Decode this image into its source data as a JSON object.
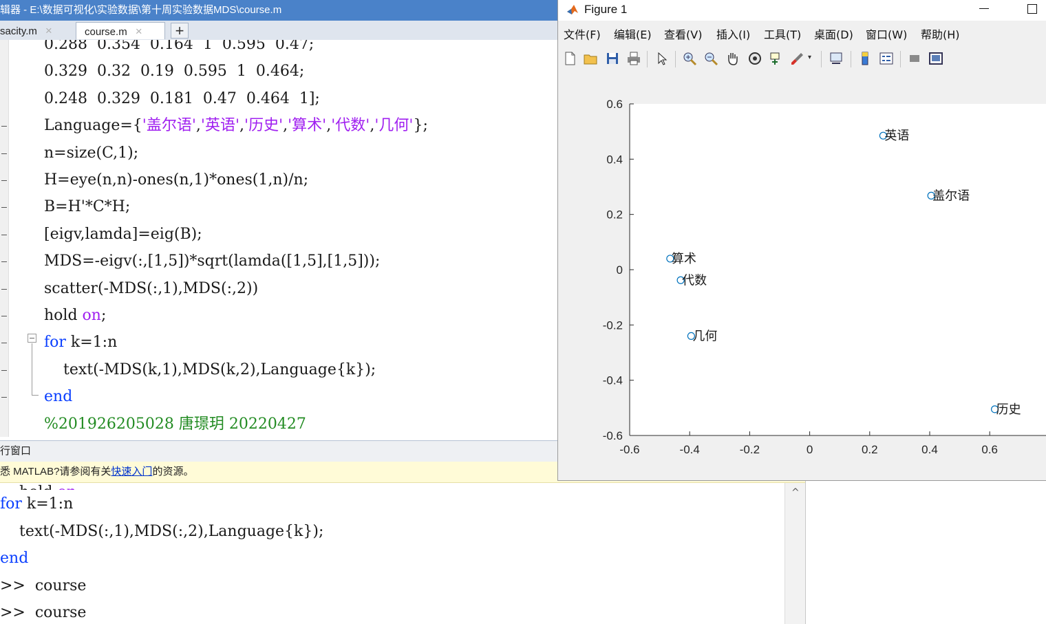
{
  "editor": {
    "title": "辑器 - E:\\数据可视化\\实验数据\\第十周实验数据MDS\\course.m",
    "tabs": [
      {
        "label": "sacity.m",
        "close": "×"
      },
      {
        "label": "course.m",
        "close": "×"
      }
    ],
    "add_tab": "+",
    "code_lines": [
      {
        "segs": [
          {
            "t": "0.288  0.354  0.164  1  0.595  0.47;",
            "c": ""
          }
        ]
      },
      {
        "segs": [
          {
            "t": "0.329  0.32  0.19  0.595  1  0.464;",
            "c": ""
          }
        ]
      },
      {
        "segs": [
          {
            "t": "0.248  0.329  0.181  0.47  0.464  1];",
            "c": ""
          }
        ]
      },
      {
        "segs": [
          {
            "t": "Language={",
            "c": ""
          },
          {
            "t": "'盖尔语'",
            "c": "str"
          },
          {
            "t": ",",
            "c": ""
          },
          {
            "t": "'英语'",
            "c": "str"
          },
          {
            "t": ",",
            "c": ""
          },
          {
            "t": "'历史'",
            "c": "str"
          },
          {
            "t": ",",
            "c": ""
          },
          {
            "t": "'算术'",
            "c": "str"
          },
          {
            "t": ",",
            "c": ""
          },
          {
            "t": "'代数'",
            "c": "str"
          },
          {
            "t": ",",
            "c": ""
          },
          {
            "t": "'几何'",
            "c": "str"
          },
          {
            "t": "};",
            "c": ""
          }
        ]
      },
      {
        "segs": [
          {
            "t": "n=size(C,1);",
            "c": ""
          }
        ]
      },
      {
        "segs": [
          {
            "t": "H=eye(n,n)-ones(n,1)*ones(1,n)/n;",
            "c": ""
          }
        ]
      },
      {
        "segs": [
          {
            "t": "B=H'*C*H;",
            "c": ""
          }
        ]
      },
      {
        "segs": [
          {
            "t": "[eigv,lamda]=eig(B);",
            "c": ""
          }
        ]
      },
      {
        "segs": [
          {
            "t": "MDS=-eigv(:,[1,5])*sqrt(lamda([1,5],[1,5]));",
            "c": ""
          }
        ]
      },
      {
        "segs": [
          {
            "t": "scatter(-MDS(:,1),MDS(:,2))",
            "c": ""
          }
        ]
      },
      {
        "segs": [
          {
            "t": "hold ",
            "c": ""
          },
          {
            "t": "on",
            "c": "str"
          },
          {
            "t": ";",
            "c": ""
          }
        ]
      },
      {
        "segs": [
          {
            "t": "for",
            "c": "kw"
          },
          {
            "t": " k=1:n",
            "c": ""
          }
        ]
      },
      {
        "segs": [
          {
            "t": "    text(-MDS(k,1),MDS(k,2),Language{k});",
            "c": ""
          }
        ]
      },
      {
        "segs": [
          {
            "t": "end",
            "c": "kw"
          }
        ]
      },
      {
        "segs": [
          {
            "t": "%201926205028 唐璟玥 20220427",
            "c": "cmt"
          }
        ]
      }
    ]
  },
  "command_window": {
    "header": "行窗口",
    "tip_prefix": "悉 MATLAB?请参阅有关",
    "tip_link": "快速入门",
    "tip_suffix": "的资源。",
    "lines": [
      {
        "segs": [
          {
            "t": "for",
            "c": "kw"
          },
          {
            "t": " k=1:n",
            "c": ""
          }
        ]
      },
      {
        "segs": [
          {
            "t": "    text(-MDS(:,1),MDS(:,2),Language{k});",
            "c": ""
          }
        ]
      },
      {
        "segs": [
          {
            "t": "end",
            "c": "kw"
          }
        ]
      },
      {
        "segs": [
          {
            "t": ">>  course",
            "c": ""
          }
        ]
      },
      {
        "segs": [
          {
            "t": ">>  course",
            "c": ""
          }
        ]
      }
    ],
    "scroll_up": "^"
  },
  "figure": {
    "title": "Figure 1",
    "menu": [
      "文件(F)",
      "编辑(E)",
      "查看(V)",
      "插入(I)",
      "工具(T)",
      "桌面(D)",
      "窗口(W)",
      "帮助(H)"
    ],
    "toolbar_icons": [
      "new-figure-icon",
      "open-file-icon",
      "save-icon",
      "print-icon",
      "pointer-icon",
      "zoom-in-icon",
      "zoom-out-icon",
      "pan-hand-icon",
      "rotate-3d-icon",
      "data-cursor-icon",
      "brush-icon",
      "link-plot-icon",
      "colorbar-icon",
      "legend-icon",
      "hide-plot-tools-icon",
      "show-plot-tools-icon"
    ]
  },
  "chart_data": {
    "type": "scatter",
    "title": "",
    "xlabel": "",
    "ylabel": "",
    "xlim": [
      -0.6,
      0.8
    ],
    "ylim": [
      -0.6,
      0.6
    ],
    "xticks": [
      "-0.6",
      "-0.4",
      "-0.2",
      "0",
      "0.2",
      "0.4",
      "0.6",
      "0"
    ],
    "yticks": [
      "0.6",
      "0.4",
      "0.2",
      "0",
      "-0.2",
      "-0.4",
      "-0.6"
    ],
    "grid": false,
    "marker_color": "#0072bd",
    "points": [
      {
        "label": "英语",
        "x": 0.245,
        "y": 0.485
      },
      {
        "label": "盖尔语",
        "x": 0.405,
        "y": 0.268
      },
      {
        "label": "算术",
        "x": -0.465,
        "y": 0.04
      },
      {
        "label": "代数",
        "x": -0.43,
        "y": -0.038
      },
      {
        "label": "几何",
        "x": -0.395,
        "y": -0.24
      },
      {
        "label": "历史",
        "x": 0.617,
        "y": -0.505
      }
    ]
  }
}
